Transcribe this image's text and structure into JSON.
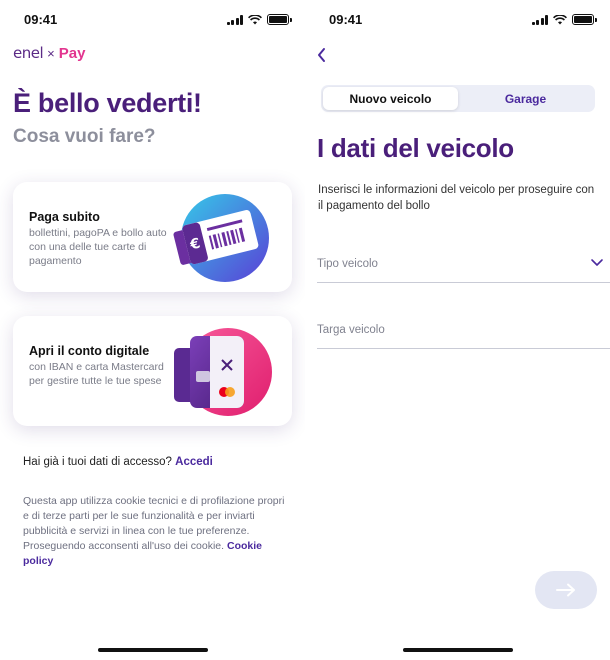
{
  "left": {
    "status": {
      "time": "09:41"
    },
    "logo": {
      "brand": "enel",
      "separator": "×",
      "product": "Pay"
    },
    "greeting": "È bello vederti!",
    "subtitle": "Cosa vuoi fare?",
    "cards": [
      {
        "title": "Paga subito",
        "description": "bollettini, pagoPA e bollo auto con una delle tue carte di pagamento",
        "icon": "payment-slip-icon"
      },
      {
        "title": "Apri il conto digitale",
        "description": "con IBAN e carta Mastercard per gestire tutte le tue spese",
        "icon": "credit-card-icon"
      }
    ],
    "access": {
      "question": "Hai già i tuoi dati di accesso?",
      "link": "Accedi"
    },
    "cookie": {
      "text": "Questa app utilizza cookie tecnici e di profilazione propri e di terze parti per le sue funzionalità e per inviarti pubblicità e servizi in linea con le tue preferenze. Proseguendo acconsenti all'uso dei cookie.",
      "link": "Cookie policy"
    }
  },
  "right": {
    "status": {
      "time": "09:41"
    },
    "tabs": [
      {
        "label": "Nuovo veicolo",
        "active": true
      },
      {
        "label": "Garage",
        "active": false
      }
    ],
    "title": "I dati del veicolo",
    "description": "Inserisci le informazioni del veicolo per proseguire con il pagamento del bollo",
    "fields": {
      "vehicle_type": {
        "placeholder": "Tipo veicolo",
        "value": ""
      },
      "plate": {
        "placeholder": "Targa veicolo",
        "value": ""
      }
    }
  },
  "colors": {
    "brand_purple": "#4a1f7a",
    "accent_pink": "#e2358f",
    "link": "#4b2a9e",
    "button_disabled": "#e3e6f3"
  }
}
